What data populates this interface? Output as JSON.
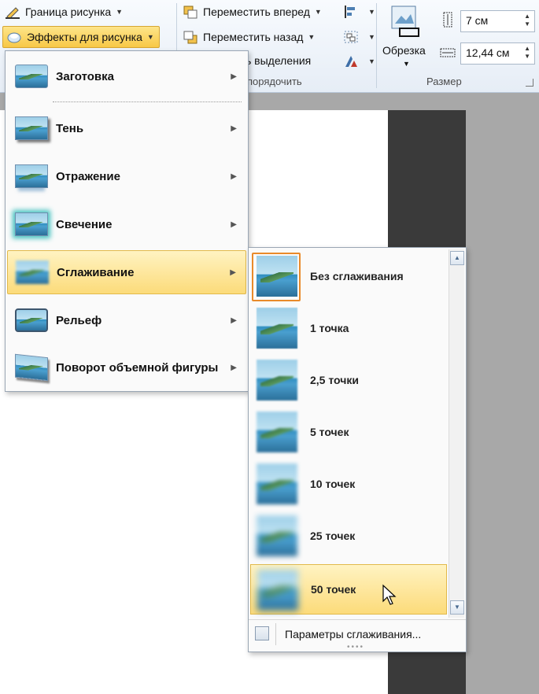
{
  "ribbon": {
    "border_label": "Граница рисунка",
    "effects_label": "Эффекты для рисунка",
    "bring_forward_label": "Переместить вперед",
    "send_backward_label": "Переместить назад",
    "selection_label": "ь выделения",
    "arrange_group_label": "порядочить",
    "crop_label": "Обрезка",
    "size_group_label": "Размер",
    "height_value": "7 см",
    "width_value": "12,44 см"
  },
  "effects_menu": {
    "items": [
      {
        "label": "Заготовка",
        "icon": "preset-icon"
      },
      {
        "label": "Тень",
        "icon": "shadow-icon"
      },
      {
        "label": "Отражение",
        "icon": "reflection-icon"
      },
      {
        "label": "Свечение",
        "icon": "glow-icon"
      },
      {
        "label": "Сглаживание",
        "icon": "soft-edges-icon"
      },
      {
        "label": "Рельеф",
        "icon": "bevel-icon"
      },
      {
        "label": "Поворот объемной фигуры",
        "icon": "3d-rotation-icon"
      }
    ],
    "selected_index": 4
  },
  "soft_edges_menu": {
    "items": [
      {
        "label": "Без сглаживания"
      },
      {
        "label": "1 точка"
      },
      {
        "label": "2,5 точки"
      },
      {
        "label": "5 точек"
      },
      {
        "label": "10 точек"
      },
      {
        "label": "25 точек"
      },
      {
        "label": "50 точек"
      }
    ],
    "selected_index": 0,
    "hovered_index": 6,
    "options_label": "Параметры сглаживания..."
  },
  "colors": {
    "highlight": "#fcdb7a",
    "highlight_border": "#e2b94a",
    "selected_frame": "#e98a2a"
  }
}
